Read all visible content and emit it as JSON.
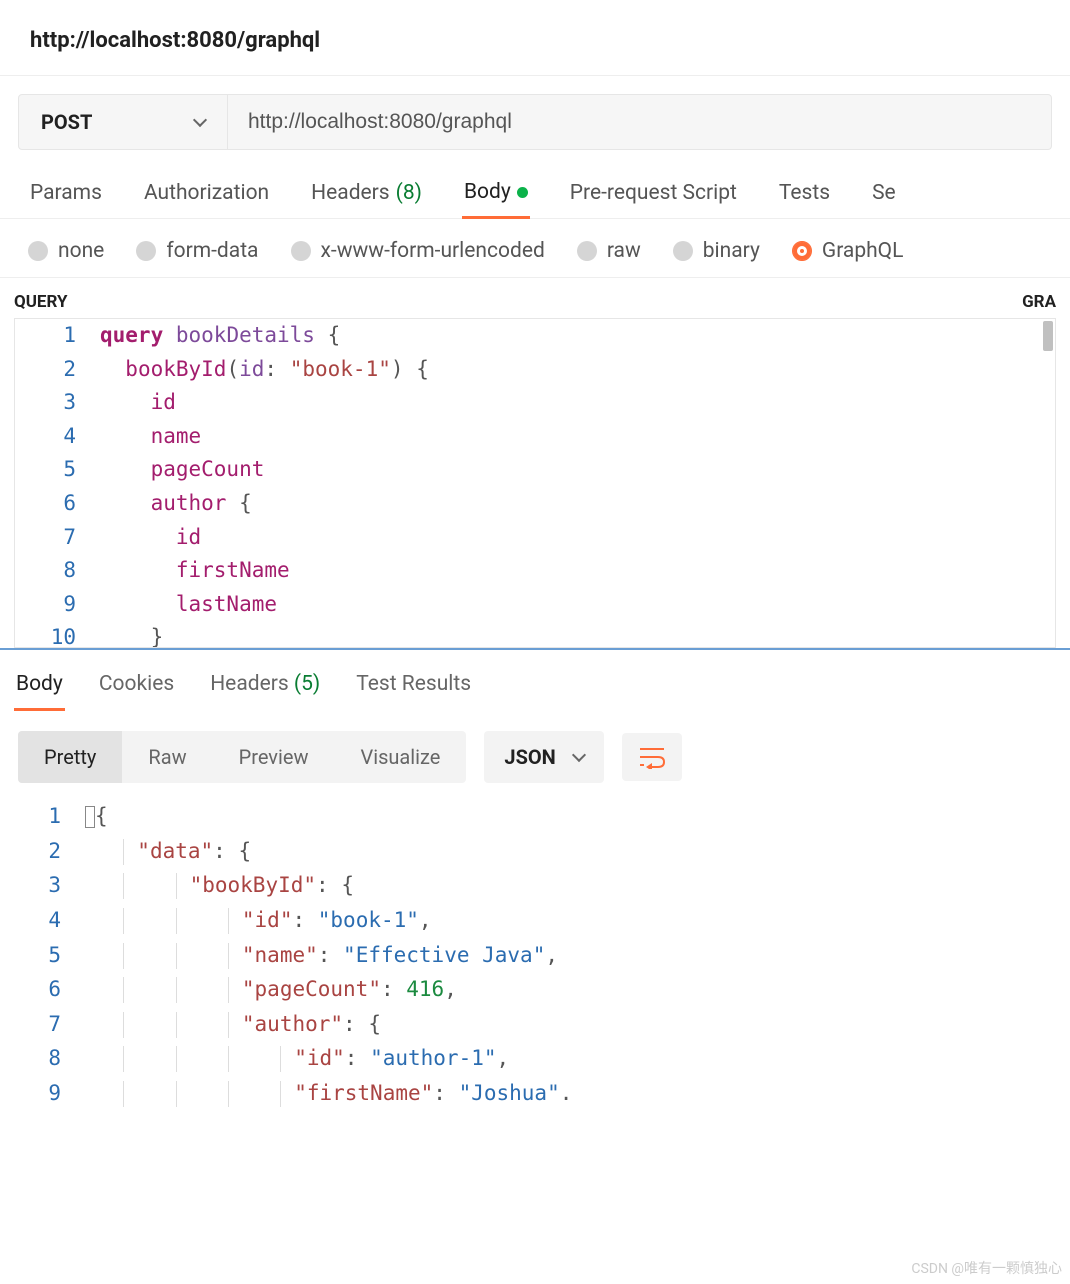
{
  "titleBar": {
    "title": "http://localhost:8080/graphql"
  },
  "request": {
    "method": "POST",
    "url": "http://localhost:8080/graphql"
  },
  "tabs": {
    "params": "Params",
    "authorization": "Authorization",
    "headers": "Headers",
    "headersCount": "(8)",
    "body": "Body",
    "prerequest": "Pre-request Script",
    "tests": "Tests",
    "settings": "Se"
  },
  "bodyTypes": {
    "none": "none",
    "formData": "form-data",
    "xwww": "x-www-form-urlencoded",
    "raw": "raw",
    "binary": "binary",
    "graphql": "GraphQL"
  },
  "querySection": {
    "label": "QUERY",
    "rightLabel": "GRA",
    "lines": [
      {
        "n": 1,
        "html": "<span class='kw-query'>query</span> <span class='kw-name'>bookDetails</span> <span class='punc'>{</span>"
      },
      {
        "n": 2,
        "html": "  <span class='field'>bookById</span><span class='punc'>(</span><span class='kw-name'>id</span><span class='punc'>:</span> <span class='str'>\"book-1\"</span><span class='punc'>)</span> <span class='punc'>{</span>"
      },
      {
        "n": 3,
        "html": "    <span class='field'>id</span>"
      },
      {
        "n": 4,
        "html": "    <span class='field'>name</span>"
      },
      {
        "n": 5,
        "html": "    <span class='field'>pageCount</span>"
      },
      {
        "n": 6,
        "html": "    <span class='field'>author</span> <span class='punc'>{</span>"
      },
      {
        "n": 7,
        "html": "      <span class='field'>id</span>"
      },
      {
        "n": 8,
        "html": "      <span class='field'>firstName</span>"
      },
      {
        "n": 9,
        "html": "      <span class='field'>lastName</span>"
      },
      {
        "n": 10,
        "html": "    <span class='punc'>}</span>"
      }
    ]
  },
  "responseTabs": {
    "body": "Body",
    "cookies": "Cookies",
    "headers": "Headers",
    "headersCount": "(5)",
    "testResults": "Test Results"
  },
  "responseViews": {
    "pretty": "Pretty",
    "raw": "Raw",
    "preview": "Preview",
    "visualize": "Visualize",
    "format": "JSON"
  },
  "responseBody": {
    "lines": [
      {
        "n": 1,
        "html": "<span class='cursor-box'></span><span class='punc'>{</span>"
      },
      {
        "n": 2,
        "html": "  <span class='guide'></span><span class='json-key'>\"data\"</span><span class='punc'>: {</span>"
      },
      {
        "n": 3,
        "html": "  <span class='guide'></span>  <span class='guide'></span><span class='json-key'>\"bookById\"</span><span class='punc'>: {</span>"
      },
      {
        "n": 4,
        "html": "  <span class='guide'></span>  <span class='guide'></span>  <span class='guide'></span><span class='json-key'>\"id\"</span><span class='punc'>: </span><span class='json-str'>\"book-1\"</span><span class='punc'>,</span>"
      },
      {
        "n": 5,
        "html": "  <span class='guide'></span>  <span class='guide'></span>  <span class='guide'></span><span class='json-key'>\"name\"</span><span class='punc'>: </span><span class='json-str'>\"Effective Java\"</span><span class='punc'>,</span>"
      },
      {
        "n": 6,
        "html": "  <span class='guide'></span>  <span class='guide'></span>  <span class='guide'></span><span class='json-key'>\"pageCount\"</span><span class='punc'>: </span><span class='json-num'>416</span><span class='punc'>,</span>"
      },
      {
        "n": 7,
        "html": "  <span class='guide'></span>  <span class='guide'></span>  <span class='guide'></span><span class='json-key'>\"author\"</span><span class='punc'>: {</span>"
      },
      {
        "n": 8,
        "html": "  <span class='guide'></span>  <span class='guide'></span>  <span class='guide'></span>  <span class='guide'></span><span class='json-key'>\"id\"</span><span class='punc'>: </span><span class='json-str'>\"author-1\"</span><span class='punc'>,</span>"
      },
      {
        "n": 9,
        "html": "  <span class='guide'></span>  <span class='guide'></span>  <span class='guide'></span>  <span class='guide'></span><span class='json-key'>\"firstName\"</span><span class='punc'>: </span><span class='json-str'>\"Joshua\"</span><span class='punc'>.</span>"
      }
    ]
  },
  "watermark": "CSDN @唯有一颗慎独心"
}
